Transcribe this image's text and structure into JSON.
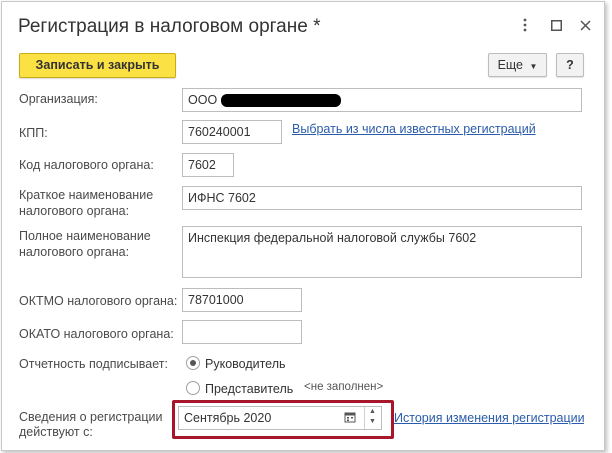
{
  "window": {
    "title": "Регистрация в налоговом органе *",
    "menu_icon": "more-vert-icon",
    "maximize_icon": "maximize-icon",
    "close_icon": "close-icon"
  },
  "toolbar": {
    "save_close_label": "Записать и закрыть",
    "more_label": "Еще",
    "help_label": "?"
  },
  "form": {
    "organization": {
      "label": "Организация:",
      "value": "ООО"
    },
    "kpp": {
      "label": "КПП:",
      "value": "760240001",
      "link": "Выбрать из числа известных регистраций"
    },
    "tax_code": {
      "label": "Код налогового органа:",
      "value": "7602"
    },
    "short_name": {
      "label_line1": "Краткое наименование",
      "label_line2": "налогового органа:",
      "value": "ИФНС 7602"
    },
    "full_name": {
      "label_line1": "Полное наименование",
      "label_line2": "налогового органа:",
      "value": "Инспекция федеральной налоговой службы 7602"
    },
    "oktmo": {
      "label": "ОКТМО налогового органа:",
      "value": "78701000"
    },
    "okato": {
      "label": "ОКАТО налогового органа:",
      "value": ""
    },
    "signer": {
      "label": "Отчетность подписывает:",
      "option1": "Руководитель",
      "option2": "Представитель",
      "option2_note": "<не заполнен>",
      "selected": "Руководитель"
    },
    "registration": {
      "label_line1": "Сведения о регистрации",
      "label_line2": "действуют с:",
      "value": "Сентябрь 2020",
      "link": "История изменения регистрации"
    }
  },
  "colors": {
    "accent_yellow": "#fbe144",
    "link_blue": "#2b5cab",
    "highlight_red": "#a8162a"
  }
}
